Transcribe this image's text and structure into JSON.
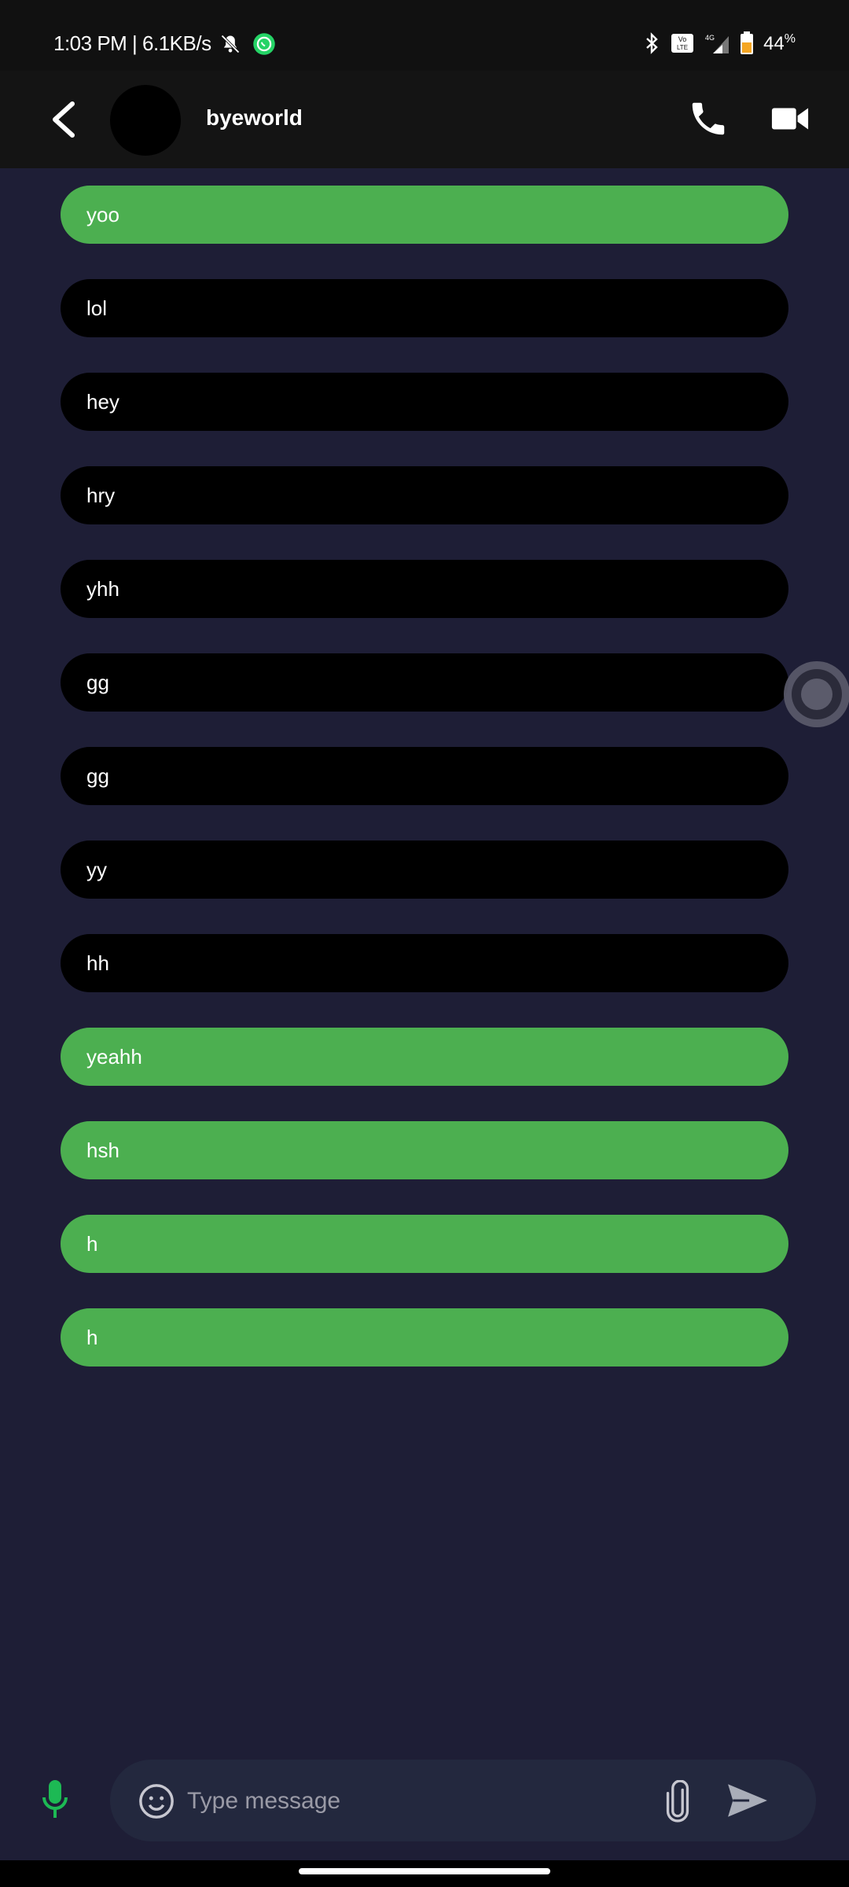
{
  "status_bar": {
    "time_speed": "1:03 PM | 6.1KB/s",
    "network_label": "4G",
    "volte_label": "Vo LTE",
    "battery": "44",
    "battery_unit": "%",
    "battery_color": "#f5a623"
  },
  "header": {
    "contact_name": "byeworld"
  },
  "messages": [
    {
      "text": "yoo",
      "type": "sent"
    },
    {
      "text": "lol",
      "type": "received"
    },
    {
      "text": "hey",
      "type": "received"
    },
    {
      "text": "hry",
      "type": "received"
    },
    {
      "text": "yhh",
      "type": "received"
    },
    {
      "text": "gg",
      "type": "received"
    },
    {
      "text": "gg",
      "type": "received"
    },
    {
      "text": "yy",
      "type": "received"
    },
    {
      "text": "hh",
      "type": "received"
    },
    {
      "text": "yeahh",
      "type": "sent"
    },
    {
      "text": "hsh",
      "type": "sent"
    },
    {
      "text": "h",
      "type": "sent"
    },
    {
      "text": "h",
      "type": "sent"
    }
  ],
  "composer": {
    "placeholder": "Type message",
    "value": ""
  },
  "colors": {
    "background": "#1e1e36",
    "sent_bubble": "#4caf50",
    "received_bubble": "#000000",
    "mic_accent": "#1db954"
  },
  "icons": {
    "back": "chevron-left-icon",
    "call": "phone-icon",
    "video": "video-camera-icon",
    "mic": "microphone-icon",
    "emoji": "smiley-icon",
    "attach": "paperclip-icon",
    "send": "send-icon",
    "floating": "assistive-touch-icon"
  }
}
